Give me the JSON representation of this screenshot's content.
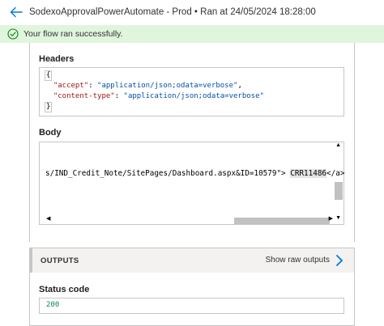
{
  "header": {
    "title": "SodexoApprovalPowerAutomate - Prod • Ran at 24/05/2024 18:28:00",
    "back_icon": "arrow-left-icon"
  },
  "banner": {
    "message": "Your flow ran successfully.",
    "icon": "check-circle-icon",
    "color": "#dff6dd"
  },
  "inputs": {
    "headers_label": "Headers",
    "headers": {
      "open_brace": "{",
      "lines": [
        {
          "key": "\"accept\"",
          "value": "\"application/json;odata=verbose\"",
          "sep": ","
        },
        {
          "key": "\"content-type\"",
          "value": "\"application/json;odata=verbose\"",
          "sep": ""
        }
      ],
      "close_brace": "}"
    },
    "body_label": "Body",
    "body": {
      "text_before": "s/IND_Credit_Note/SitePages/Dashboard.aspx&ID=10579\"> ",
      "highlight": "CRR11486",
      "text_after": "</a>"
    }
  },
  "outputs": {
    "title": "OUTPUTS",
    "raw_link": "Show raw outputs",
    "status_label": "Status code",
    "status_value": "200"
  },
  "colors": {
    "accent": "#0078d4",
    "success": "#107c10",
    "json_key": "#a31515",
    "json_value": "#0451a5",
    "number": "#098658"
  }
}
